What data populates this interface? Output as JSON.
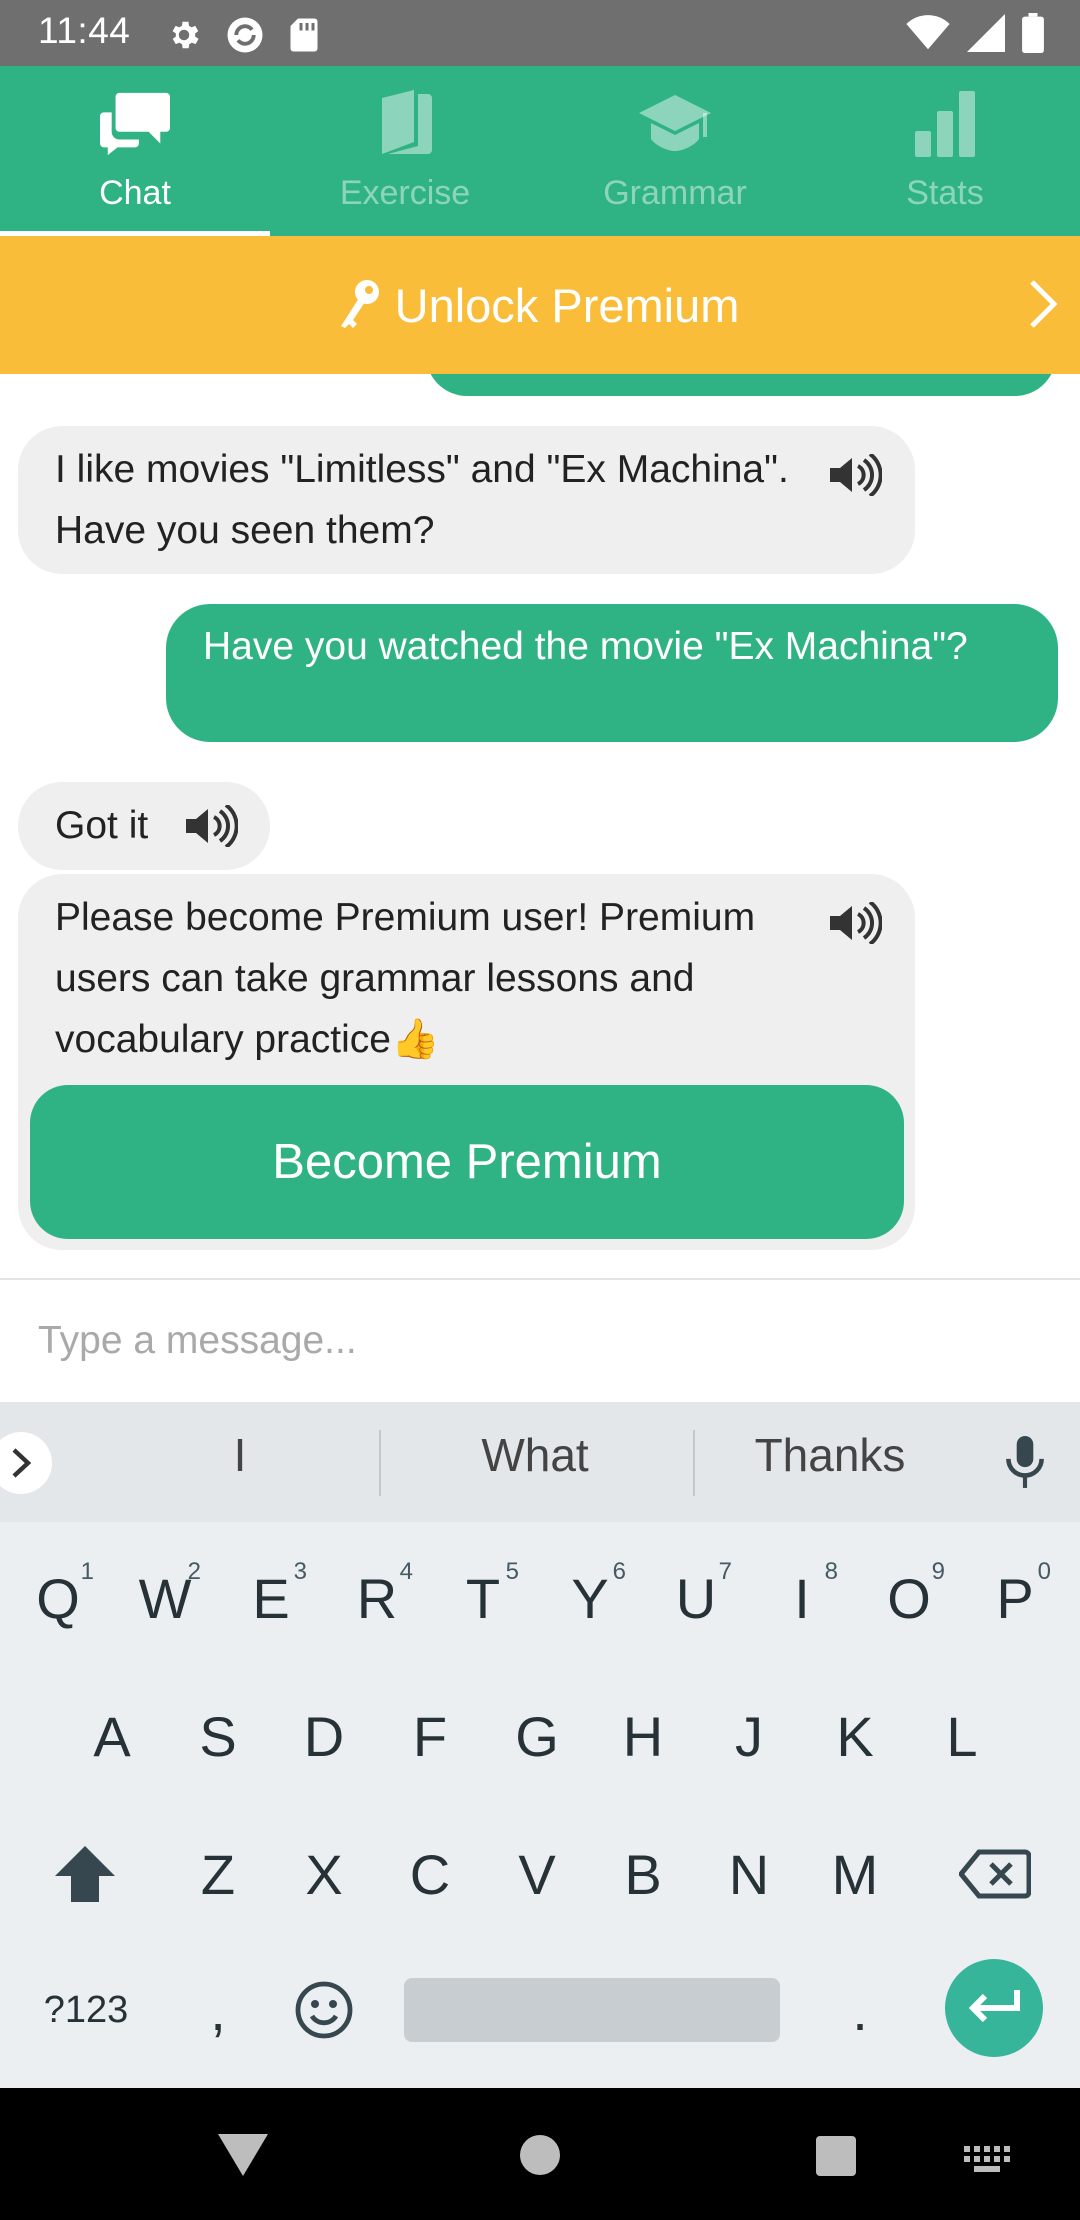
{
  "status_bar": {
    "time": "11:44"
  },
  "tabs": [
    {
      "label": "Chat",
      "icon": "chat-bubbles-icon",
      "active": true
    },
    {
      "label": "Exercise",
      "icon": "book-icon",
      "active": false
    },
    {
      "label": "Grammar",
      "icon": "graduation-cap-icon",
      "active": false
    },
    {
      "label": "Stats",
      "icon": "bar-chart-icon",
      "active": false
    }
  ],
  "banner": {
    "label": "Unlock Premium"
  },
  "messages": [
    {
      "from": "bot",
      "text": "I like movies \"Limitless\" and \"Ex Machina\". Have you seen them?"
    },
    {
      "from": "user",
      "text": "Have you watched the movie \"Ex Machina\"?"
    },
    {
      "from": "bot",
      "text": "Got it"
    },
    {
      "from": "bot",
      "text": "Please become Premium user! Premium users can take grammar lessons and vocabulary practice👍"
    }
  ],
  "premium_button": {
    "label": "Become Premium"
  },
  "input": {
    "placeholder": "Type a message..."
  },
  "keyboard": {
    "suggestions": [
      "I",
      "What",
      "Thanks"
    ],
    "row1": [
      "Q",
      "W",
      "E",
      "R",
      "T",
      "Y",
      "U",
      "I",
      "O",
      "P"
    ],
    "row1_hints": [
      "1",
      "2",
      "3",
      "4",
      "5",
      "6",
      "7",
      "8",
      "9",
      "0"
    ],
    "row2": [
      "A",
      "S",
      "D",
      "F",
      "G",
      "H",
      "J",
      "K",
      "L"
    ],
    "row3": [
      "Z",
      "X",
      "C",
      "V",
      "B",
      "N",
      "M"
    ],
    "symbols_label": "?123",
    "comma": ",",
    "period": "."
  },
  "colors": {
    "brand_green": "#2fb385",
    "banner_yellow": "#f9bd3a",
    "bubble_gray": "#efefef"
  }
}
